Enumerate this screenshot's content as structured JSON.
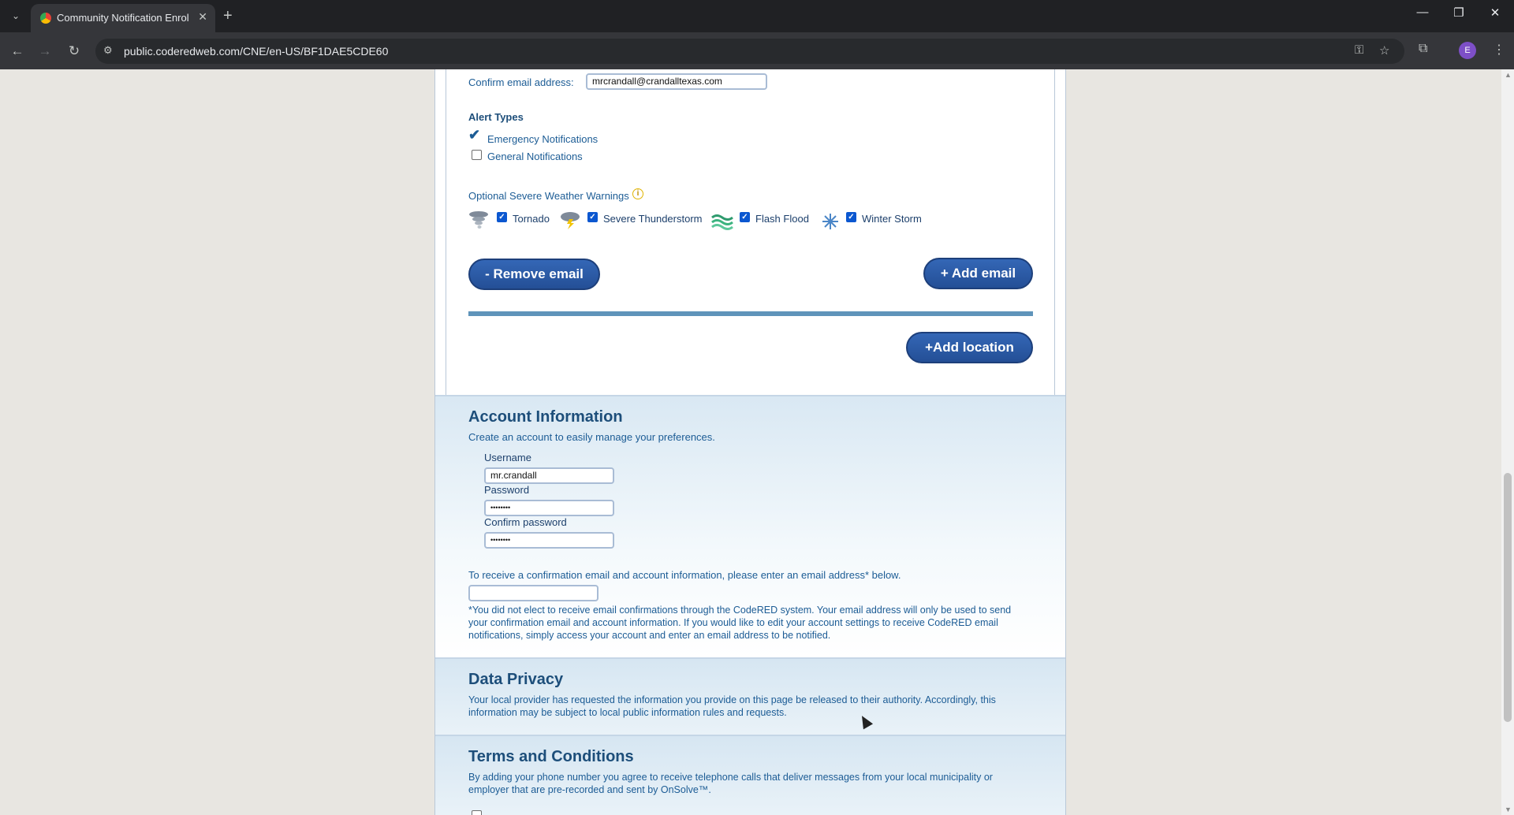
{
  "browser": {
    "tab_title": "Community Notification Enrollm",
    "url": "public.coderedweb.com/CNE/en-US/BF1DAE5CDE60",
    "avatar_letter": "E"
  },
  "email_section": {
    "confirm_email_label": "Confirm email address:",
    "confirm_email_value": "mrcrandall@crandalltexas.com",
    "alert_types_title": "Alert Types",
    "emergency_label": "Emergency Notifications",
    "general_label": "General Notifications",
    "severe_title": "Optional Severe Weather Warnings",
    "weather": [
      {
        "label": "Tornado",
        "checked": true
      },
      {
        "label": "Severe Thunderstorm",
        "checked": true
      },
      {
        "label": "Flash Flood",
        "checked": true
      },
      {
        "label": "Winter Storm",
        "checked": true
      }
    ],
    "remove_email_button": "- Remove email",
    "add_email_button": "+ Add email",
    "add_location_button": "+Add location"
  },
  "account": {
    "title": "Account Information",
    "subtitle": "Create an account to easily manage your preferences.",
    "username_label": "Username",
    "username_value": "mr.crandall",
    "password_label": "Password",
    "password_value": "••••••••",
    "confirm_password_label": "Confirm password",
    "confirm_password_value": "••••••••",
    "confirm_email_prompt": "To receive a confirmation email and account information, please enter an email address* below.",
    "confirm_email_note": "*You did not elect to receive email confirmations through the CodeRED system. Your email address will only be used to send your confirmation email and account information. If you would like to edit your account settings to receive CodeRED email notifications, simply access your account and enter an email address to be notified."
  },
  "privacy": {
    "title": "Data Privacy",
    "text": "Your local provider has requested the information you provide on this page be released to their authority. Accordingly, this information may be subject to local public information rules and requests."
  },
  "terms": {
    "title": "Terms and Conditions",
    "text": "By adding your phone number you agree to receive telephone calls that deliver messages from your local municipality or employer that are pre-recorded and sent by OnSolve™."
  }
}
